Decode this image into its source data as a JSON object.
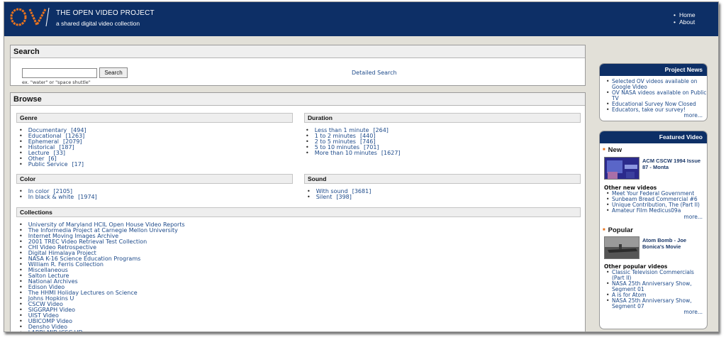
{
  "header": {
    "logo_text": "OV",
    "title": "THE OPEN VIDEO PROJECT",
    "subtitle": "a shared digital video collection",
    "nav": [
      "Home",
      "About"
    ]
  },
  "search": {
    "heading": "Search",
    "input_value": "",
    "button_label": "Search",
    "hint": "ex. \"water\" or \"space shuttle\"",
    "detailed_link": "Detailed Search"
  },
  "browse": {
    "heading": "Browse",
    "genre": {
      "title": "Genre",
      "items": [
        {
          "label": "Documentary",
          "count": "[494]"
        },
        {
          "label": "Educational",
          "count": "[1263]"
        },
        {
          "label": "Ephemeral",
          "count": "[2079]"
        },
        {
          "label": "Historical",
          "count": "[187]"
        },
        {
          "label": "Lecture",
          "count": "[33]"
        },
        {
          "label": "Other",
          "count": "[6]"
        },
        {
          "label": "Public Service",
          "count": "[17]"
        }
      ]
    },
    "duration": {
      "title": "Duration",
      "items": [
        {
          "label": "Less than 1 minute",
          "count": "[264]"
        },
        {
          "label": "1 to 2 minutes",
          "count": "[440]"
        },
        {
          "label": "2 to 5 minutes",
          "count": "[746]"
        },
        {
          "label": "5 to 10 minutes",
          "count": "[701]"
        },
        {
          "label": "More than 10 minutes",
          "count": "[1627]"
        }
      ]
    },
    "color": {
      "title": "Color",
      "items": [
        {
          "label": "In color",
          "count": "[2105]"
        },
        {
          "label": "In black & white",
          "count": "[1974]"
        }
      ]
    },
    "sound": {
      "title": "Sound",
      "items": [
        {
          "label": "With sound",
          "count": "[3681]"
        },
        {
          "label": "Silent",
          "count": "[398]"
        }
      ]
    },
    "collections": {
      "title": "Collections",
      "items": [
        "University of Maryland HCIL Open House Video Reports",
        "The Informedia Project at Carnegie Mellon University",
        "Internet Moving Images Archive",
        "2001 TREC Video Retrieval Test Collection",
        "CHI Video Retrospective",
        "Digital Himalaya Project",
        "NASA K-16 Science Education Programs",
        "William R. Ferris Collection",
        "Miscellaneous",
        "Salton Lecture",
        "National Archives",
        "Edison Video",
        "The HHMI Holiday Lectures on Science",
        "Johns Hopkins U",
        "CSCW Video",
        "SIGGRAPH Video",
        "UIST Video",
        "UBICOMP Video",
        "Densho Video",
        "LABRI-MIR ICSC UD"
      ]
    }
  },
  "sidebar": {
    "news": {
      "title": "Project News",
      "items": [
        "Selected OV videos available on Google Video",
        "OV NASA videos available on Public TV",
        "Educational Survey Now Closed",
        "Educators, take our survey!"
      ],
      "more": "more..."
    },
    "featured": {
      "title": "Featured Video",
      "new_heading": "New",
      "new_title": "ACM CSCW 1994 Issue 87 - Monta",
      "other_new_label": "Other new videos",
      "other_new": [
        "Meet Your Federal Government",
        "Sunbeam Bread Commercial #6",
        "Unique Contribution, The (Part II)",
        "Amateur Film Medicus09a"
      ],
      "more": "more...",
      "popular_heading": "Popular",
      "popular_title": "Atom Bomb - Joe Bonica's Movie",
      "other_popular_label": "Other popular videos",
      "other_popular": [
        "Classic Television Commercials (Part II)",
        "NASA 25th Anniversary Show, Segment 01",
        "A is for Atom",
        "NASA 25th Anniversary Show, Segment 07"
      ],
      "more2": "more..."
    }
  },
  "colors": {
    "header_bg": "#0d2f66",
    "logo_orange": "#e8731e",
    "link": "#1d4a8a",
    "page_bg": "#e2e0d8"
  }
}
